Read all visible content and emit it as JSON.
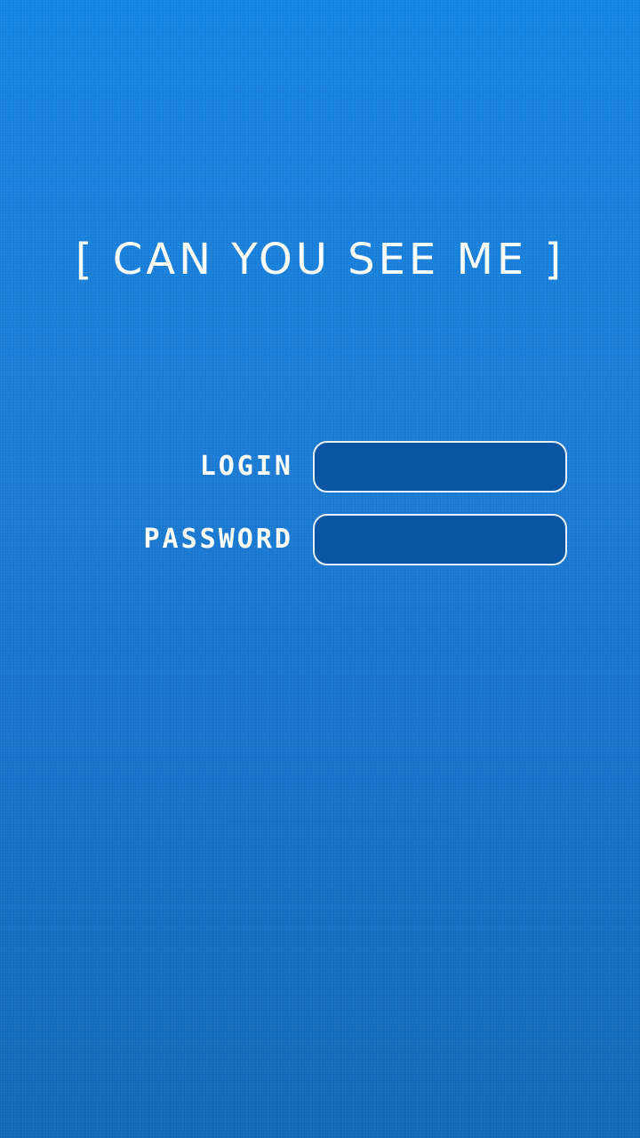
{
  "screen": {
    "title": "[ CAN YOU SEE ME ]",
    "background_colors": [
      "#1285e3",
      "#1268b9"
    ]
  },
  "form": {
    "login": {
      "label": "LOGIN",
      "value": "",
      "placeholder": ""
    },
    "password": {
      "label": "PASSWORD",
      "value": "",
      "placeholder": ""
    },
    "field_fill_color": "#0b55a5",
    "field_border_color": "#e8f1fb"
  }
}
